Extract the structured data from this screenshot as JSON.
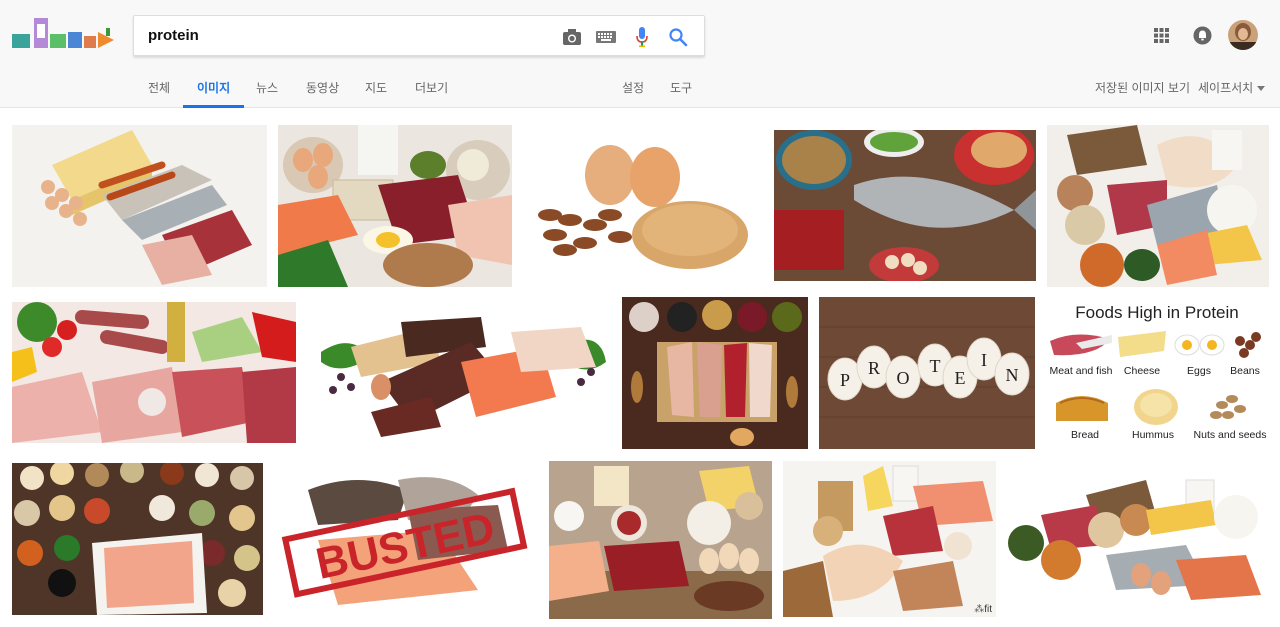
{
  "search": {
    "query": "protein"
  },
  "tabs": [
    "전체",
    "이미지",
    "뉴스",
    "동영상",
    "지도",
    "더보기"
  ],
  "tools": {
    "settings": "설정",
    "tools": "도구"
  },
  "right_links": {
    "saved": "저장된 이미지 보기",
    "safesearch": "세이프서치"
  },
  "icons": [
    "camera-icon",
    "keyboard-icon",
    "mic-icon",
    "search-icon",
    "apps-grid-icon",
    "notifications-icon",
    "avatar"
  ],
  "colors": {
    "accent": "#1a73e8",
    "mic": "#4285f4"
  },
  "results": {
    "foods_high_in_protein": {
      "title": "Foods High in Protein",
      "items": [
        "Meat and fish",
        "Cheese",
        "Eggs",
        "Beans",
        "Bread",
        "Hummus",
        "Nuts and seeds"
      ]
    },
    "busted_stamp": "BUSTED",
    "protein_eggs_letters": [
      "P",
      "R",
      "O",
      "T",
      "E",
      "I",
      "N"
    ],
    "watermark": "fit"
  }
}
